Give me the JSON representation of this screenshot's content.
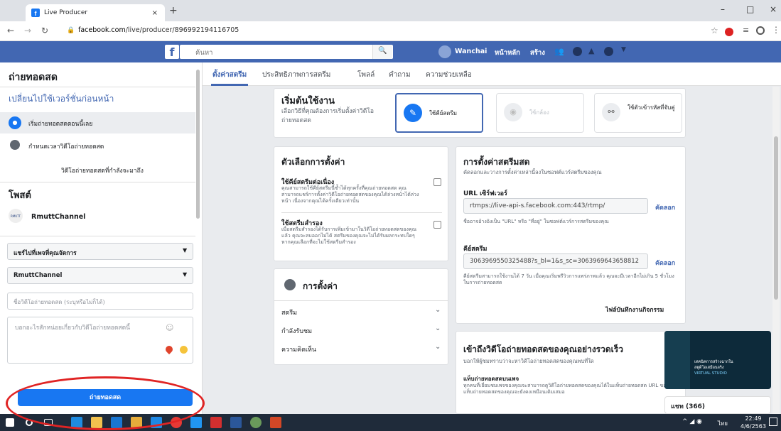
{
  "browser": {
    "tab_title": "Live Producer",
    "tab_close": "×",
    "new_tab": "+",
    "url_prefix": "facebook.com",
    "url_path": "/live/producer/896992194116705",
    "minimize": "–",
    "restore": "□",
    "close": "×"
  },
  "fbnav": {
    "logo": "f",
    "search_placeholder": "ค้นหา",
    "user": "Wanchai",
    "home": "หน้าหลัก",
    "create": "สร้าง"
  },
  "sidebar": {
    "title": "ถ่ายทอดสด",
    "switch_link": "เปลี่ยนไปใช้เวอร์ชั่นก่อนหน้า",
    "items": [
      {
        "label": "เริ่มถ่ายทอดสดตอนนี้เลย"
      },
      {
        "label": "กำหนดเวลาวิดีโอถ่ายทอดสด"
      },
      {
        "label": "วิดีโอถ่ายทอดสดที่กำลังจะมาถึง"
      }
    ],
    "post_heading": "โพสต์",
    "page_name": "RmuttChannel",
    "page_avatar_text": "RMUTT",
    "share_select": "แชร์ไปที่เพจที่คุณจัดการ",
    "page_select": "RmuttChannel",
    "title_placeholder": "ชื่อวิดีโอถ่ายทอดสด (ระบุหรือไม่ก็ได้)",
    "desc_placeholder": "บอกอะไรสักหน่อยเกี่ยวกับวิดีโอถ่ายทอดสดนี้",
    "go_live_button": "ถ่ายทอดสด"
  },
  "tabs": [
    "ตั้งค่าสตรีม",
    "ประสิทธิภาพการสตรีม",
    "โพลล์",
    "คำถาม",
    "ความช่วยเหลือ"
  ],
  "get_started": {
    "title": "เริ่มต้นใช้งาน",
    "subtitle": "เลือกวิธีที่คุณต้องการเริ่มตั้งค่าวิดีโอถ่ายทอดสด",
    "options": [
      {
        "label": "ใช้คีย์สตรีม"
      },
      {
        "label": "ใช้กล้อง"
      },
      {
        "label": "ใช้ตัวเข้ารหัสที่จับคู่"
      }
    ]
  },
  "setup_options": {
    "title": "ตัวเลือกการตั้งค่า",
    "persistent_label": "ใช้คีย์สตรีมต่อเนื่อง",
    "persistent_desc": "คุณสามารถใช้คีย์สตรีมนี้ซ้ำได้ทุกครั้งที่คุณถ่ายทอดสด คุณสามารถแชร์การตั้งค่าวิดีโอถ่ายทอดสดของคุณได้ล่วงหน้าได้ล่วงหน้า เนื่องจากคุณได้ครั้งเดียวเท่านั้น",
    "backup_label": "ใช้สตรีมสำรอง",
    "backup_desc": "เมื่อสตรีมสำรองได้รับการเพิ่มเข้ามาในวิดีโอถ่ายทอดสดของคุณแล้ว คุณจะลบออกไม่ได้ สตรีมของคุณจะไม่ได้รับผลกระทบใดๆ หากคุณเลือกที่จะไม่ใช้สตรีมสำรอง"
  },
  "settings": {
    "title": "การตั้งค่า",
    "rows": [
      {
        "label": "สตรีม"
      },
      {
        "label": "กำลังรับชม"
      },
      {
        "label": "ความคิดเห็น"
      }
    ]
  },
  "stream_setup": {
    "title": "การตั้งค่าสตรีมสด",
    "subtitle": "คัดลอกและวางการตั้งค่าเหล่านี้ลงในซอฟต์แวร์สตรีมของคุณ",
    "server_label": "URL เซิร์ฟเวอร์",
    "server_url": "rtmps://live-api-s.facebook.com:443/rtmp/",
    "copy": "คัดลอก",
    "server_hint": "ชื่ออาจอ้างอิงเป็น \"URL\" หรือ \"ที่อยู่\" ในซอฟต์แวร์การสตรีมของคุณ",
    "key_label": "คีย์สตรีม",
    "stream_key": "3063969550325488?s_bl=1&s_sc=3063969643658812",
    "key_hint": "คีย์สตรีมสามารถใช้งานได้ 7 วัน เมื่อคุณเริ่มพรีวิวการแพร่ภาพแล้ว คุณจะมีเวลาอีกไม่เกิน 5 ชั่วโมงในการถ่ายทอดสด",
    "log_button": "ไฟล์บันทึกงานกิจกรรม"
  },
  "reach": {
    "title": "เข้าถึงวิดีโอถ่ายทอดสดของคุณอย่างรวดเร็ว",
    "subtitle": "บอกให้ผู้ชมทราบว่าจะหาวิดีโอถ่ายทอดสดของคุณพบที่ใด",
    "sub_heading": "แท็บถ่ายทอดสดบนเพจ",
    "sub_desc": "ทุกคนที่เยี่ยมชมเพจของคุณจะสามารถดูวิดีโอถ่ายทอดสดของคุณได้ในแท็บถ่ายทอดสด URL ของแท็บถ่ายทอดสดของคุณจะยังคงเหมือนเดิมเสมอ"
  },
  "chat": {
    "label": "แชท (366)"
  },
  "video_overlay": {
    "line1": "เทคนิคการสร้างฉากใน",
    "line2": "สตูดิโอเสมือนจริง",
    "line3": "VIRTUAL STUDIO"
  },
  "taskbar": {
    "time": "22:49",
    "date": "4/6/2563",
    "lang": "ไทย"
  }
}
